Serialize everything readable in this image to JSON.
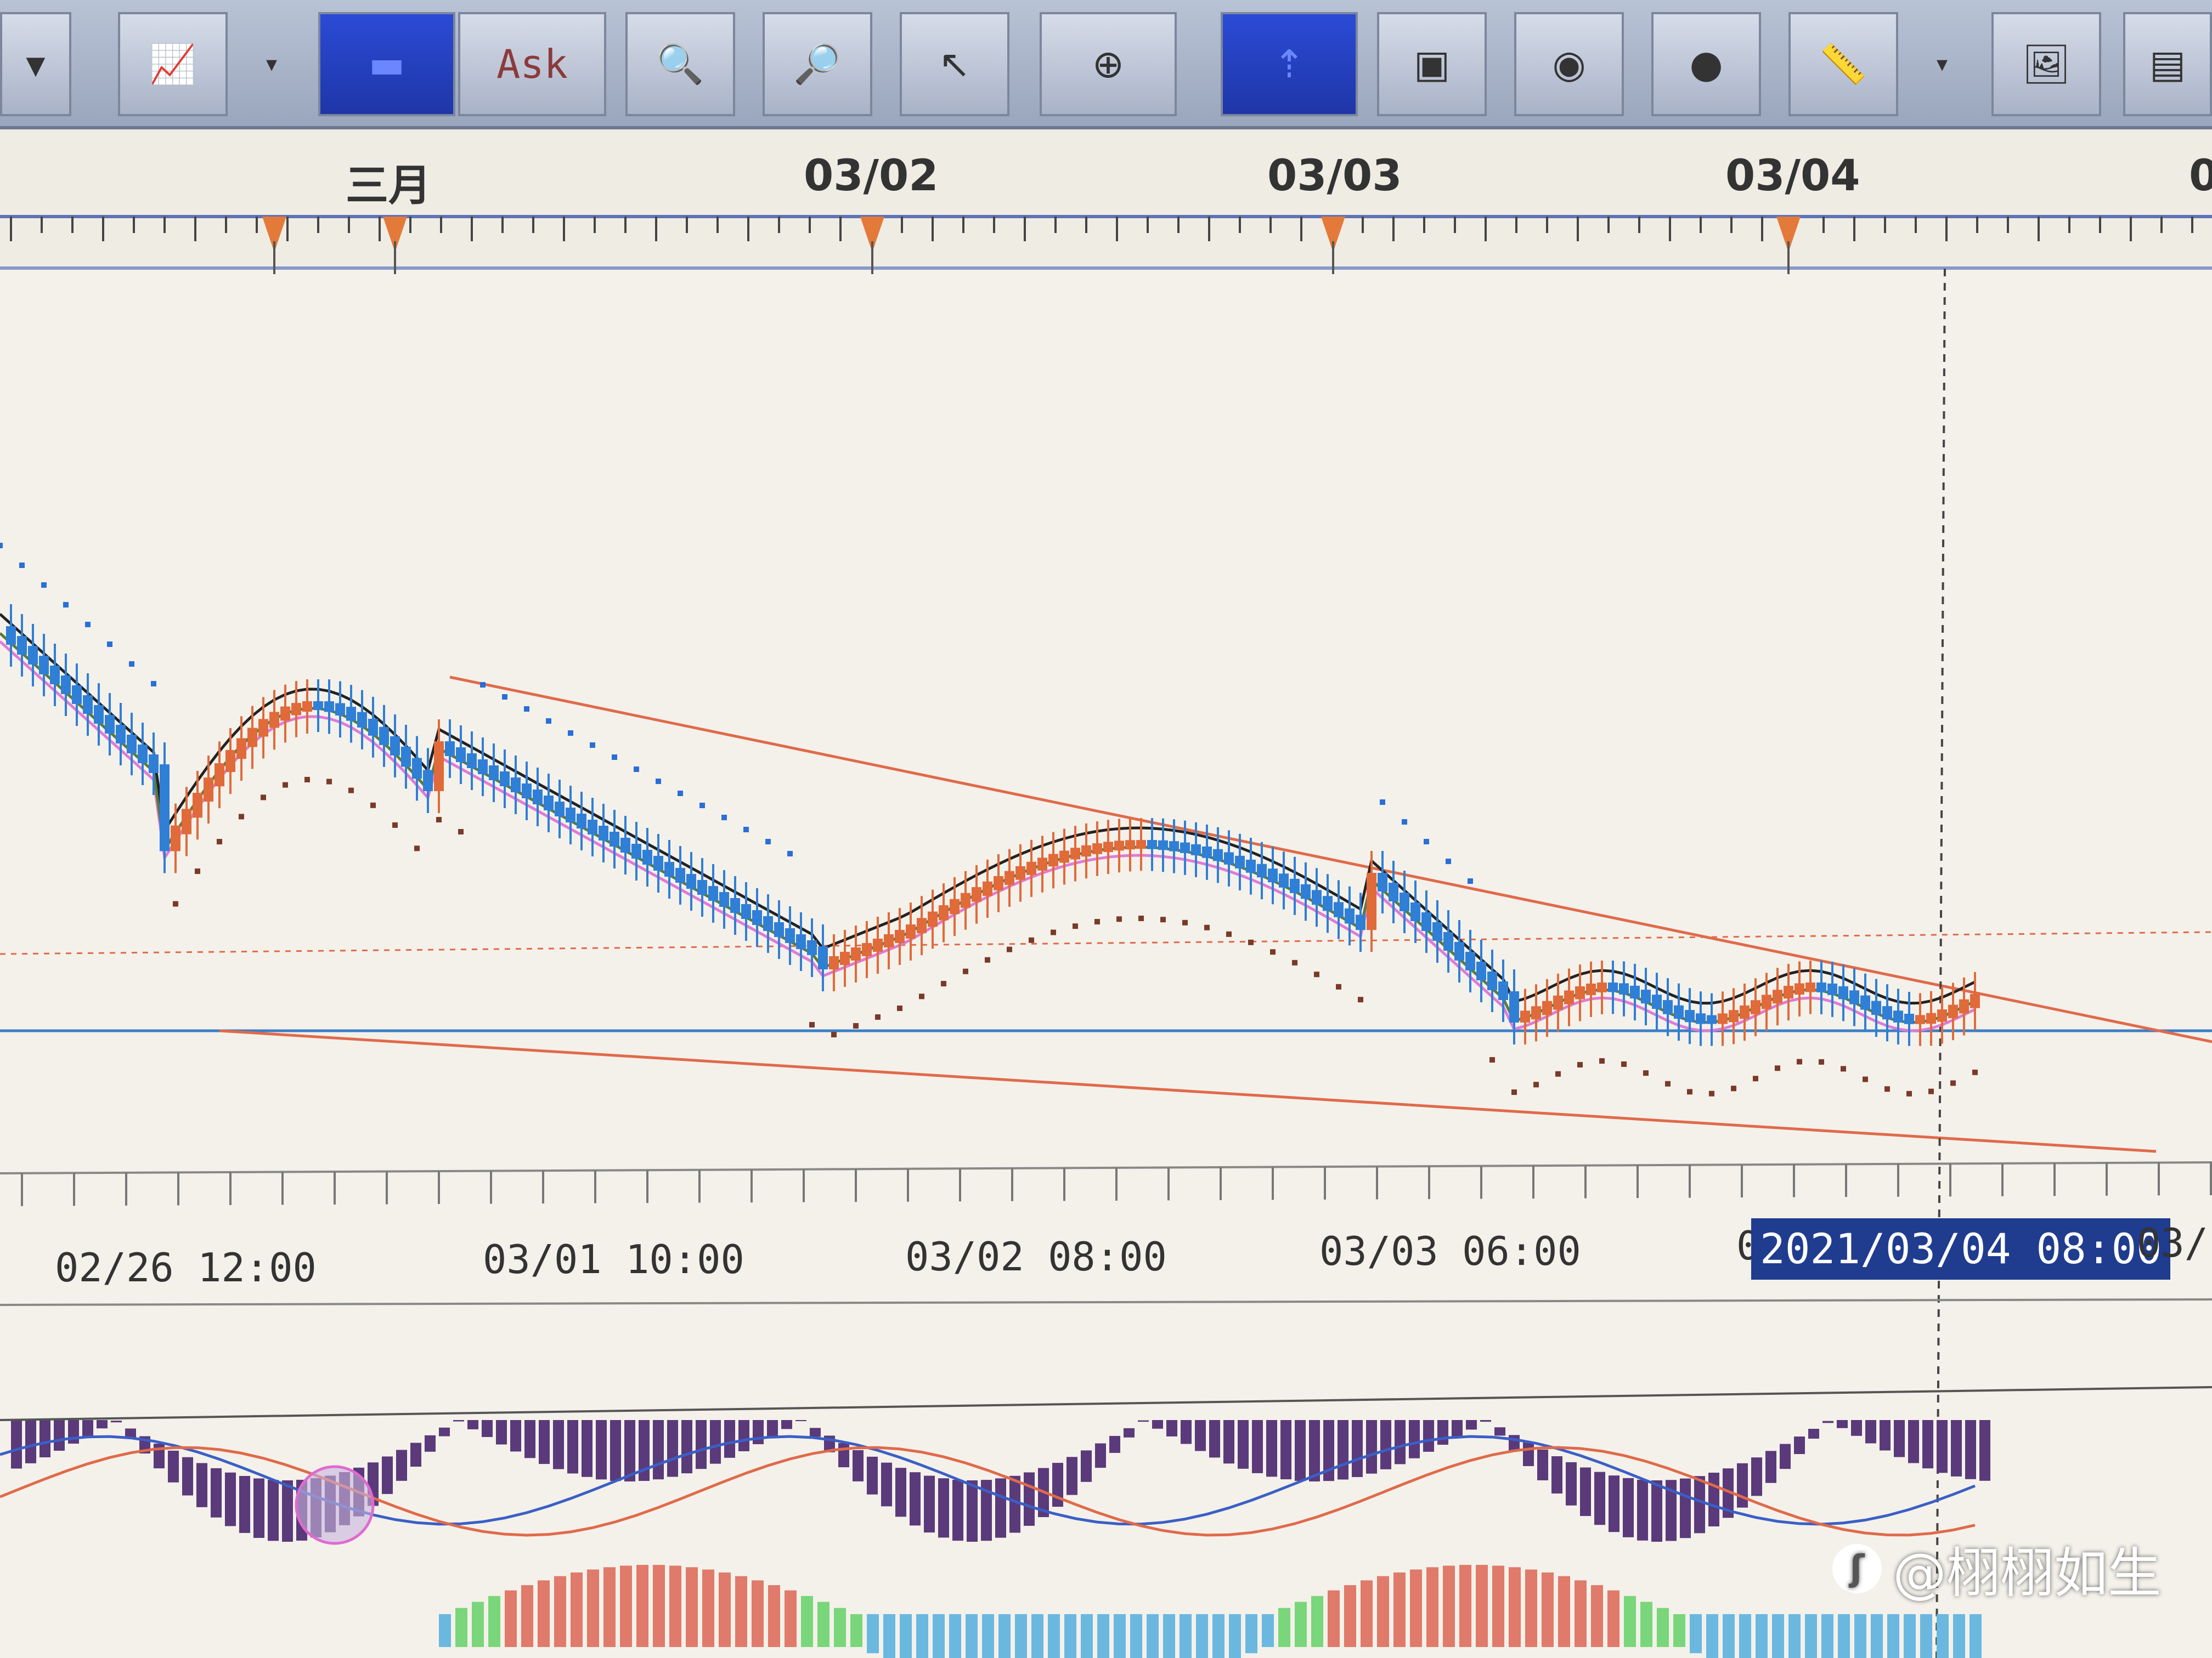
{
  "toolbar": {
    "ask_label": "Ask",
    "buttons": [
      "chart-type",
      "bid",
      "ask",
      "zoom-in",
      "zoom-out",
      "cursor",
      "crosshair-zoom",
      "auto-scroll",
      "screenshot",
      "view",
      "globe",
      "ruler",
      "template",
      "window"
    ]
  },
  "date_axis": {
    "labels": [
      "三月",
      "03/02",
      "03/03",
      "03/04",
      "0"
    ]
  },
  "time_axis": {
    "labels": [
      "02/26 12:00",
      "03/01 10:00",
      "03/02 08:00",
      "03/03 06:00",
      "03/("
    ],
    "cursor_label": "2021/03/04 08:00",
    "cursor_prefix": "0"
  },
  "watermark": {
    "text": "@栩栩如生"
  },
  "colors": {
    "up_candle": "#e06a3a",
    "down_candle": "#2f7fd6",
    "ma_fast": "#e07ad6",
    "ma_mid": "#5a7a3a",
    "ma_slow": "#222222",
    "sar_above": "#2a6fd6",
    "sar_below": "#7a3a2a",
    "trendline": "#e06a4a",
    "support": "#3a7fc6",
    "macd_hist": "#5a3a7a",
    "macd_signal": "#e06a4a",
    "macd_line": "#3a5fc6"
  },
  "chart_data": {
    "type": "candlestick",
    "indicators": [
      "moving averages (3)",
      "parabolic SAR",
      "MACD histogram",
      "MACD lines",
      "oscillator histogram"
    ],
    "annotations": [
      "descending upper trendline",
      "descending lower trendline",
      "horizontal support line",
      "dashed horizontal line",
      "vertical cursor line"
    ],
    "grid": false
  }
}
